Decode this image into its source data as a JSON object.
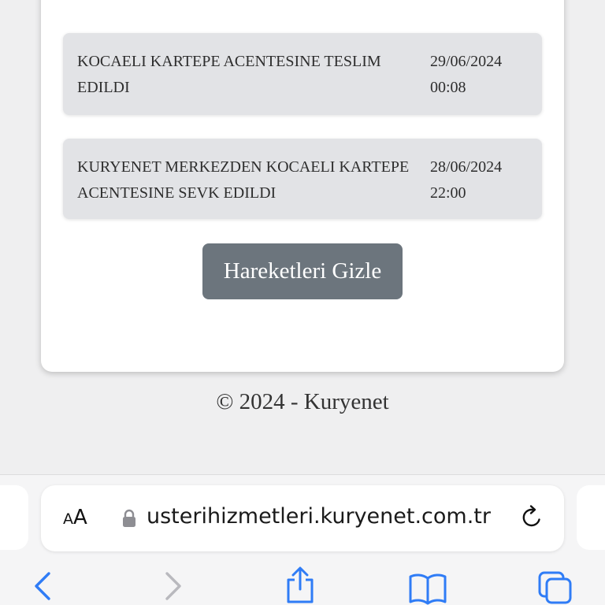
{
  "events": [
    {
      "description": "KOCAELI KARTEPE ACENTESINE TESLIM EDILDI",
      "datetime": "29/06/2024\n00:08"
    },
    {
      "description": "KURYENET MERKEZDEN KOCAELI KARTEPE ACENTESINE SEVK EDILDI",
      "datetime": "28/06/2024\n22:00"
    }
  ],
  "hide_button_label": "Hareketleri Gizle",
  "footer_text": "© 2024 - Kuryenet",
  "browser": {
    "text_size_label_small": "A",
    "text_size_label_large": "A",
    "url": "usterihizmetleri.kuryenet.com.tr",
    "accent_color": "#2f7cf6",
    "icons": [
      "back-icon",
      "forward-icon",
      "share-icon",
      "bookmarks-icon",
      "tabs-icon",
      "lock-icon",
      "reload-icon"
    ]
  }
}
